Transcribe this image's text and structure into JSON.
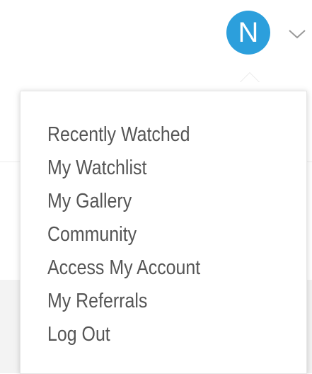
{
  "header": {
    "avatar_initial": "N",
    "avatar_color": "#2c9fdc",
    "chevron_icon": "chevron-down-icon"
  },
  "menu": {
    "items": [
      {
        "label": "Recently Watched"
      },
      {
        "label": "My Watchlist"
      },
      {
        "label": "My Gallery"
      },
      {
        "label": "Community"
      },
      {
        "label": "Access My Account"
      },
      {
        "label": "My Referrals"
      },
      {
        "label": "Log Out"
      }
    ]
  }
}
